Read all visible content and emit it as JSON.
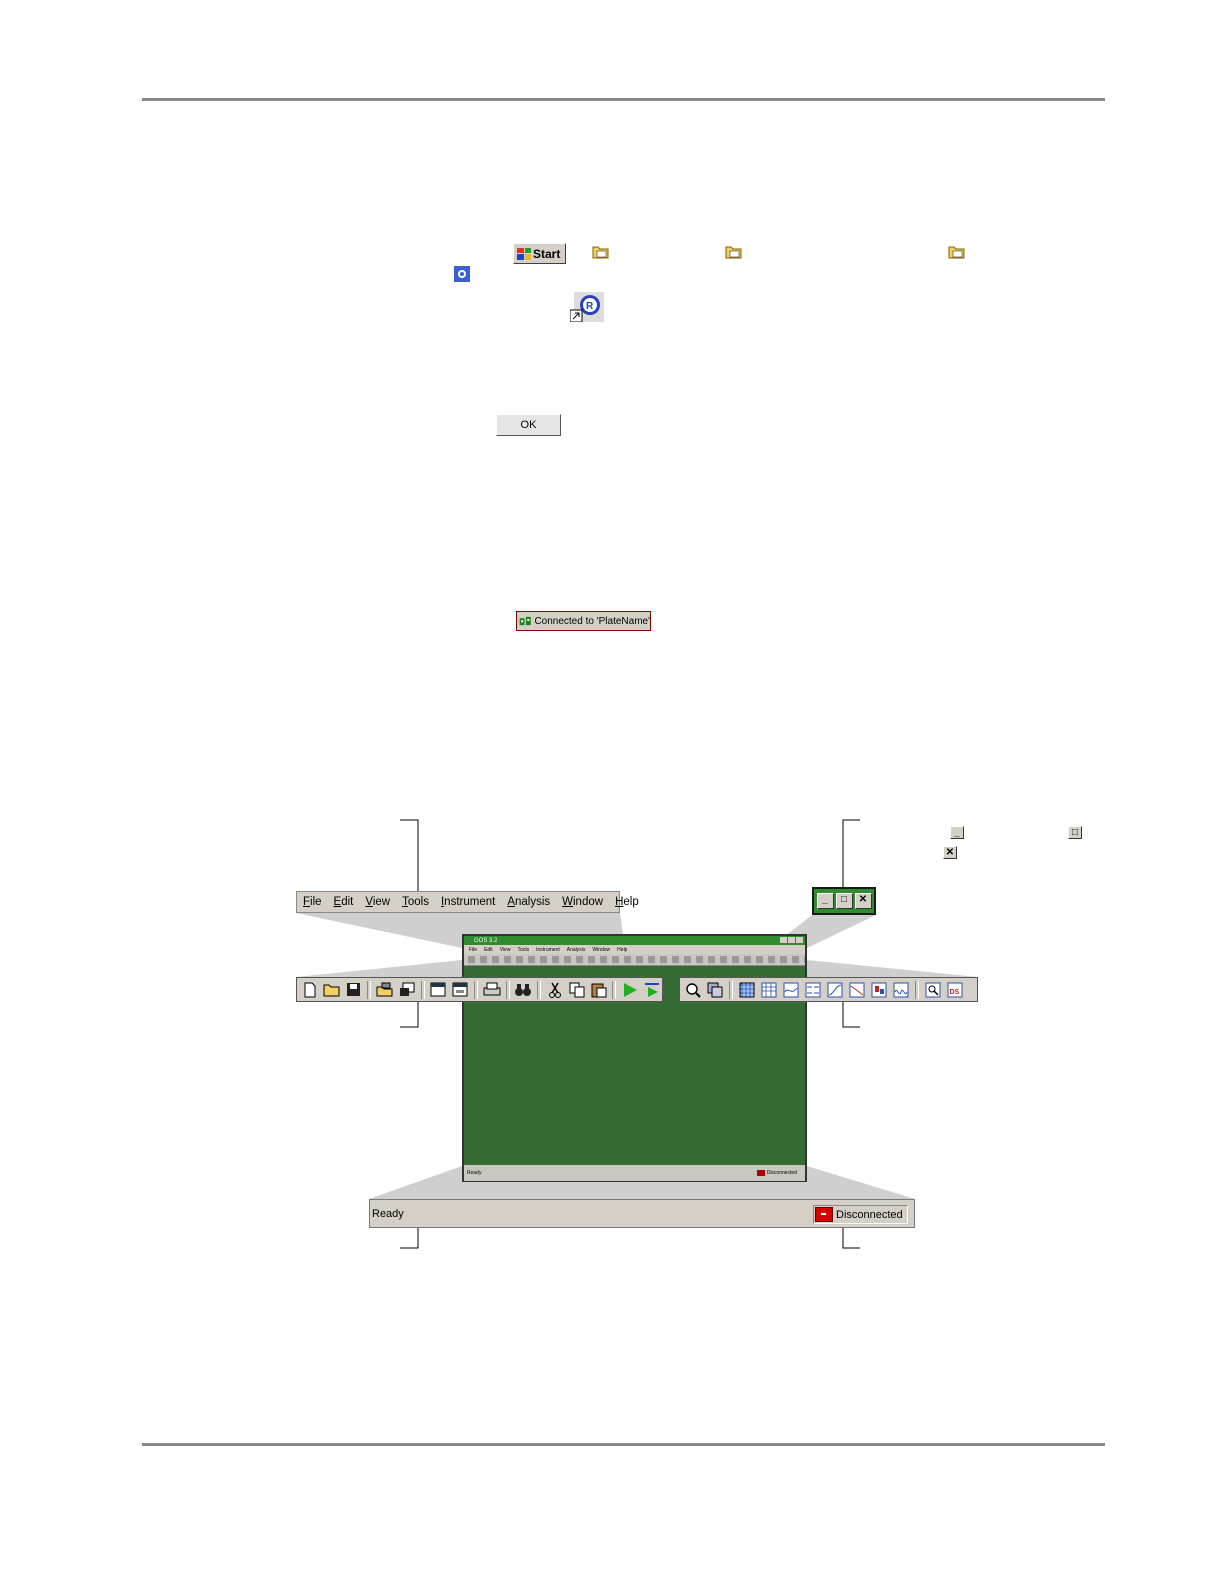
{
  "start_button": {
    "label": "Start"
  },
  "ok_button": {
    "label": "OK"
  },
  "connection_indicator": {
    "label": "Connected to 'PlateName'"
  },
  "menu": [
    "File",
    "Edit",
    "View",
    "Tools",
    "Instrument",
    "Analysis",
    "Window",
    "Help"
  ],
  "app_window": {
    "title": "GOS 3.2",
    "status": "Ready",
    "connection": "Disconnected"
  },
  "statusbar": {
    "status_text": "Ready",
    "connection_text": "Disconnected"
  },
  "colors": {
    "window_bg": "#356c35",
    "title_bar": "#2e8b2e",
    "disconnected": "#d40000"
  }
}
